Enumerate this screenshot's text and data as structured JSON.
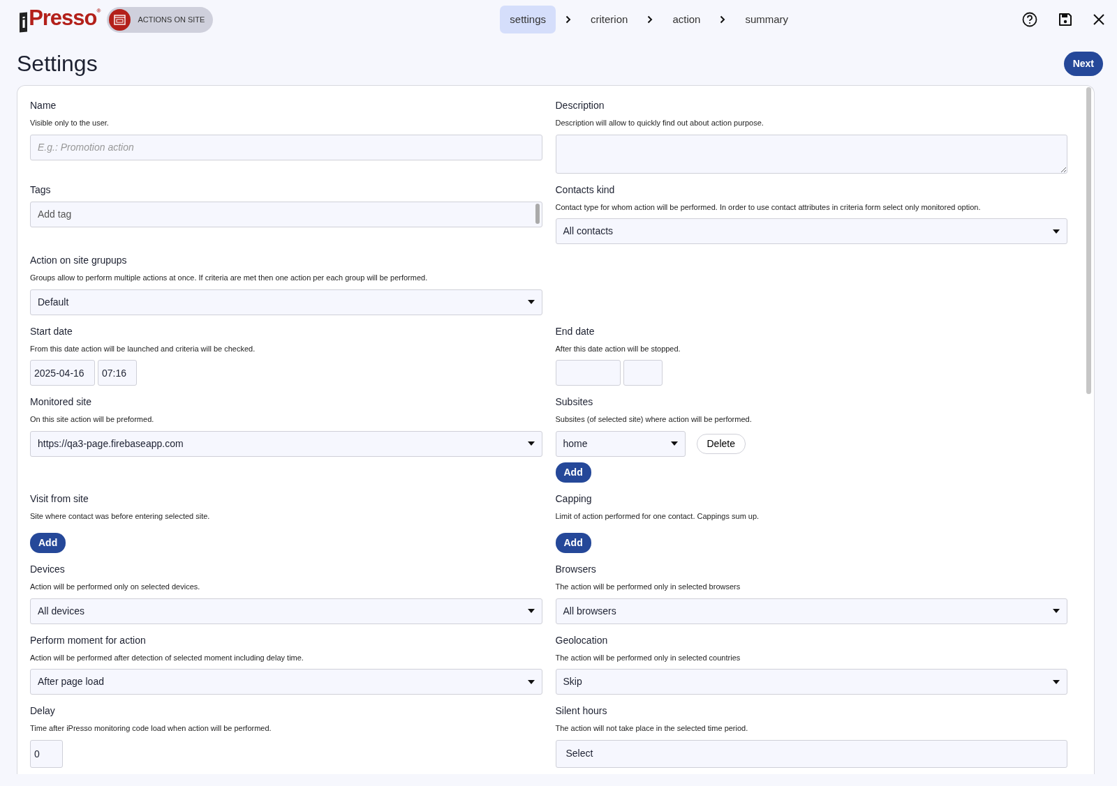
{
  "header": {
    "logo": {
      "mark": "i",
      "text": "Presso",
      "registered": "®"
    },
    "module": "ACTIONS ON SITE",
    "steps": [
      {
        "label": "settings",
        "selected": true
      },
      {
        "label": "criterion",
        "selected": false
      },
      {
        "label": "action",
        "selected": false
      },
      {
        "label": "summary",
        "selected": false
      }
    ]
  },
  "page_title": "Settings",
  "next_button": "Next",
  "form_rows": [
    {
      "left": {
        "kind": "text",
        "label": "Name",
        "help": "Visible only to the user.",
        "placeholder": "E.g.: Promotion action"
      },
      "right": {
        "kind": "textarea",
        "label": "Description",
        "help": "Description will allow to quickly find out about action purpose."
      }
    },
    {
      "left": {
        "kind": "tags",
        "label": "Tags",
        "placeholder": "Add tag"
      },
      "right": {
        "kind": "select",
        "label": "Contacts kind",
        "help": "Contact type for whom action will be performed. In order to use contact attributes in criteria form select only monitored option.",
        "value": "All contacts"
      }
    },
    {
      "left": {
        "kind": "select",
        "label": "Action on site grupups",
        "help": "Groups allow to perform multiple actions at once. If criteria are met then one action per each group will be performed.",
        "value": "Default"
      }
    },
    {
      "left": {
        "kind": "datetime",
        "label": "Start date",
        "help": "From this date action will be launched and criteria will be checked.",
        "date": "2025-04-16",
        "time": "07:16"
      },
      "right": {
        "kind": "datetime",
        "label": "End date",
        "help": "After this date action will be stopped."
      }
    },
    {
      "left": {
        "kind": "select",
        "label": "Monitored site",
        "help": "On this site action will be preformed.",
        "value": "https://qa3-page.firebaseapp.com"
      },
      "right": {
        "kind": "subsites",
        "label": "Subsites",
        "help": "Subsites (of selected site) where action will be performed.",
        "value": "home",
        "delete": "Delete",
        "add": "Add"
      }
    },
    {
      "left": {
        "kind": "add",
        "label": "Visit from site",
        "help": "Site where contact was before entering selected site.",
        "add": "Add"
      },
      "right": {
        "kind": "add",
        "label": "Capping",
        "help": "Limit of action performed for one contact. Cappings sum up.",
        "add": "Add"
      }
    },
    {
      "left": {
        "kind": "select",
        "label": "Devices",
        "help": "Action will be performed only on selected devices.",
        "value": "All devices"
      },
      "right": {
        "kind": "select",
        "label": "Browsers",
        "help": "The action will be performed only in selected browsers",
        "value": "All browsers"
      }
    },
    {
      "left": {
        "kind": "select",
        "label": "Perform moment for action",
        "help": "Action will be performed after detection of selected moment including delay time.",
        "value": "After page load"
      },
      "right": {
        "kind": "select",
        "label": "Geolocation",
        "help": "The action will be performed only in selected countries",
        "value": "Skip"
      }
    },
    {
      "left": {
        "kind": "number",
        "label": "Delay",
        "help": "Time after iPresso monitoring code load when action will be performed.",
        "value": "0"
      },
      "right": {
        "kind": "picker",
        "label": "Silent hours",
        "help": "The action will not take place in the selected time period.",
        "value": "Select"
      }
    }
  ]
}
